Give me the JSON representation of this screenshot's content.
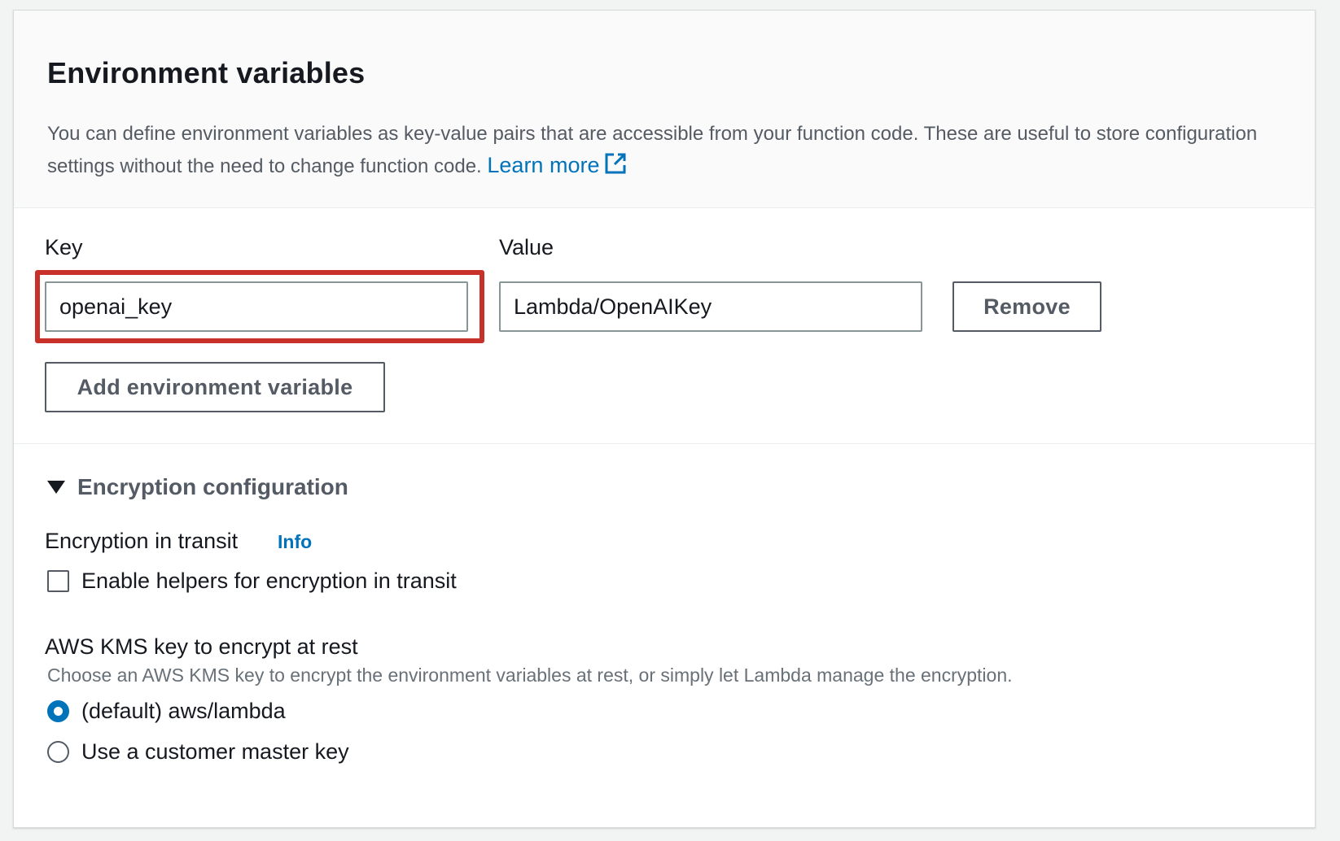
{
  "section": {
    "title": "Environment variables",
    "description": "You can define environment variables as key-value pairs that are accessible from your function code. These are useful to store configuration settings without the need to change function code.",
    "learn_more": "Learn more"
  },
  "variables": {
    "key_label": "Key",
    "value_label": "Value",
    "key_value": "openai_key",
    "value_value": "Lambda/OpenAIKey",
    "remove_button": "Remove",
    "add_button": "Add environment variable"
  },
  "encryption": {
    "expander_label": "Encryption configuration",
    "in_transit_label": "Encryption in transit",
    "info_link": "Info",
    "checkbox_label": "Enable helpers for encryption in transit",
    "checkbox_checked": false,
    "kms_label": "AWS KMS key to encrypt at rest",
    "kms_description": "Choose an AWS KMS key to encrypt the environment variables at rest, or simply let Lambda manage the encryption.",
    "options": [
      {
        "label": "(default) aws/lambda",
        "selected": true
      },
      {
        "label": "Use a customer master key",
        "selected": false
      }
    ]
  },
  "colors": {
    "link": "#0073bb",
    "highlight_border": "#c8312a",
    "radio_selected": "#0073bb"
  },
  "icons": {
    "external_link": "external-link-icon",
    "caret": "caret-down-icon"
  }
}
